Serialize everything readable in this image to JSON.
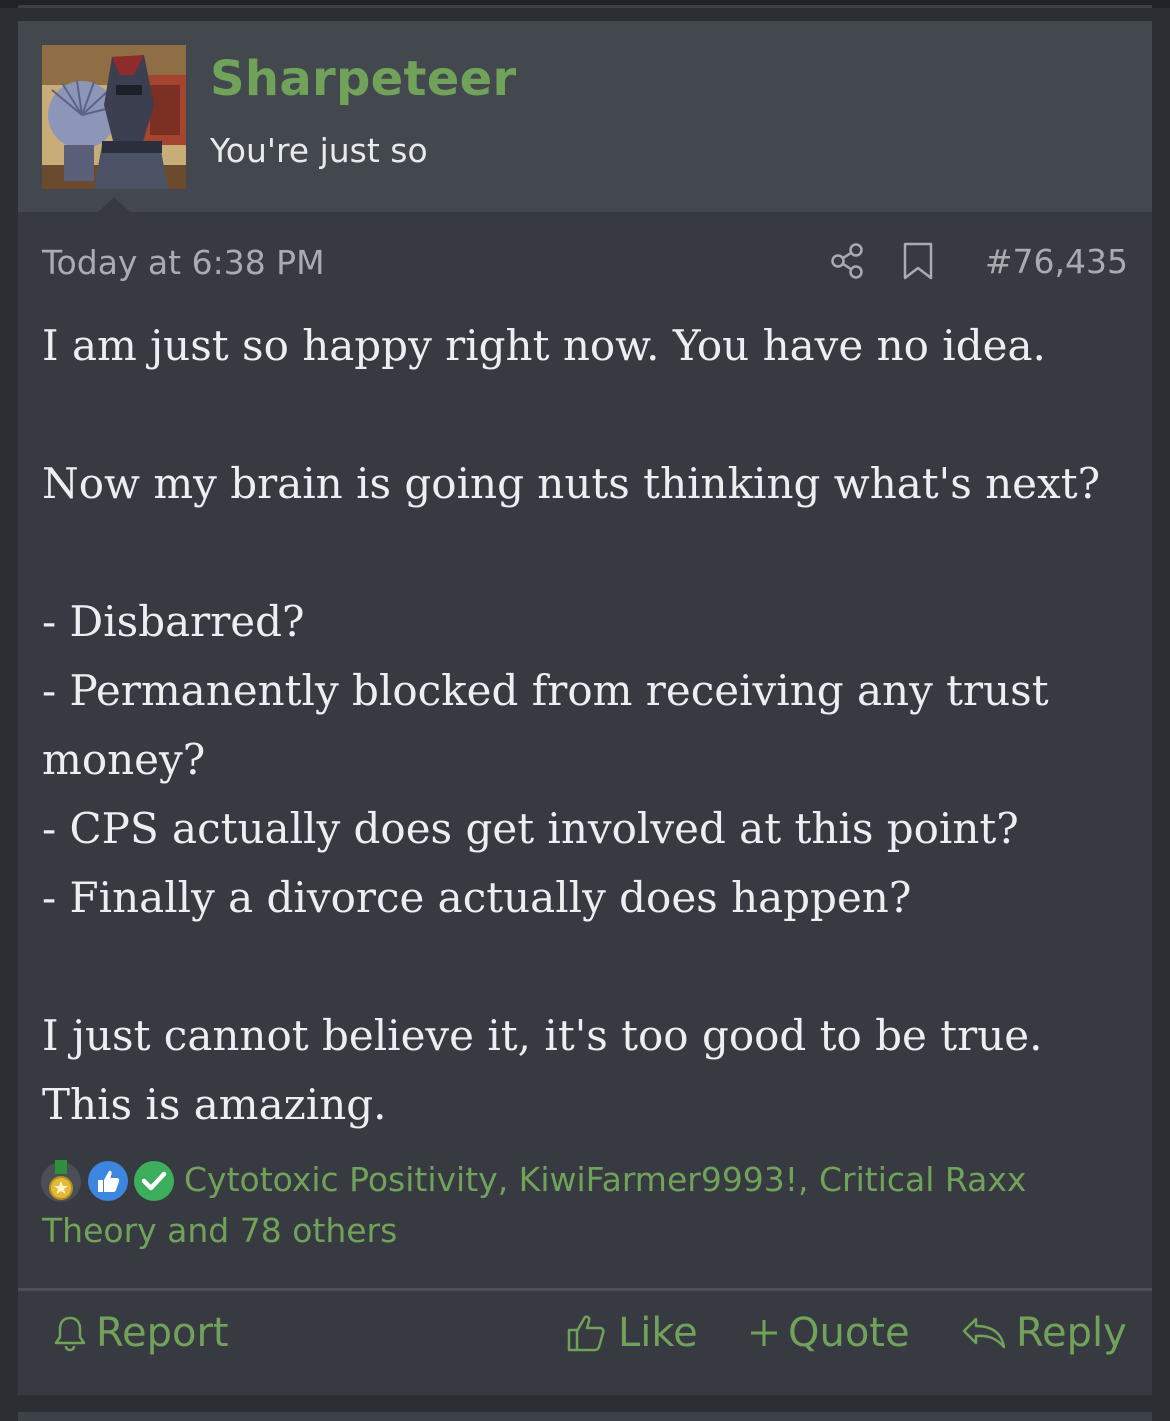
{
  "post": {
    "username": "Sharpeteer",
    "user_title": "You're just so",
    "date": "Today at 6:38 PM",
    "post_number": "#76,435",
    "body": {
      "line1": "I am just so happy right now. You have no idea.",
      "line2": "Now my brain is going nuts thinking what's next?",
      "line3": "- Disbarred?",
      "line4": "- Permanently blocked from receiving any trust money?",
      "line5": "- CPS actually does get involved at this point?",
      "line6": "- Finally a divorce actually does happen?",
      "line7": "I just cannot believe it, it's too good to be true. This is amazing."
    },
    "reactions": {
      "icons": [
        "medal-icon",
        "thumbs-up-reaction-icon",
        "checkmark-reaction-icon"
      ],
      "names_line1": "Cytotoxic Positivity, KiwiFarmer9993!, Critical Raxx",
      "names_line2": "Theory and 78 others"
    },
    "actions": {
      "report": "Report",
      "like": "Like",
      "quote": "Quote",
      "reply": "Reply"
    }
  },
  "colors": {
    "accent": "#71a25a",
    "background": "#373a41",
    "header": "#43474e",
    "text": "#eceef1",
    "muted": "#a8abb0"
  }
}
